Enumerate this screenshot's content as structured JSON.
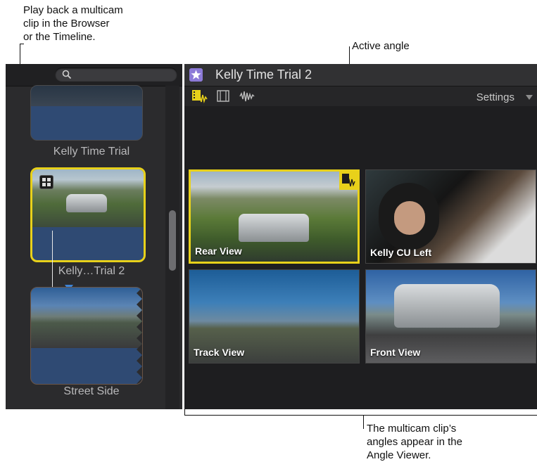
{
  "callouts": {
    "playback": "Play back a multicam\nclip in the Browser\nor the Timeline.",
    "active_angle": "Active angle",
    "angles": "The multicam clip’s\nangles appear in the\nAngle Viewer."
  },
  "browser": {
    "clips": [
      {
        "name": "Kelly Time Trial"
      },
      {
        "name": "Kelly…Trial 2"
      },
      {
        "name": "Street Side"
      }
    ]
  },
  "viewer": {
    "title": "Kelly Time Trial 2",
    "settings_label": "Settings",
    "angles": [
      {
        "label": "Rear View",
        "active": true
      },
      {
        "label": "Kelly CU Left",
        "active": false
      },
      {
        "label": "Track View",
        "active": false
      },
      {
        "label": "Front View",
        "active": false
      }
    ]
  },
  "colors": {
    "active_highlight": "#e8d11a",
    "clip_title_star": "#8c7ad7"
  },
  "icons": [
    "search-icon",
    "star-icon",
    "video-audio-icon",
    "video-only-icon",
    "audio-waveform-icon",
    "multicam-icon"
  ]
}
